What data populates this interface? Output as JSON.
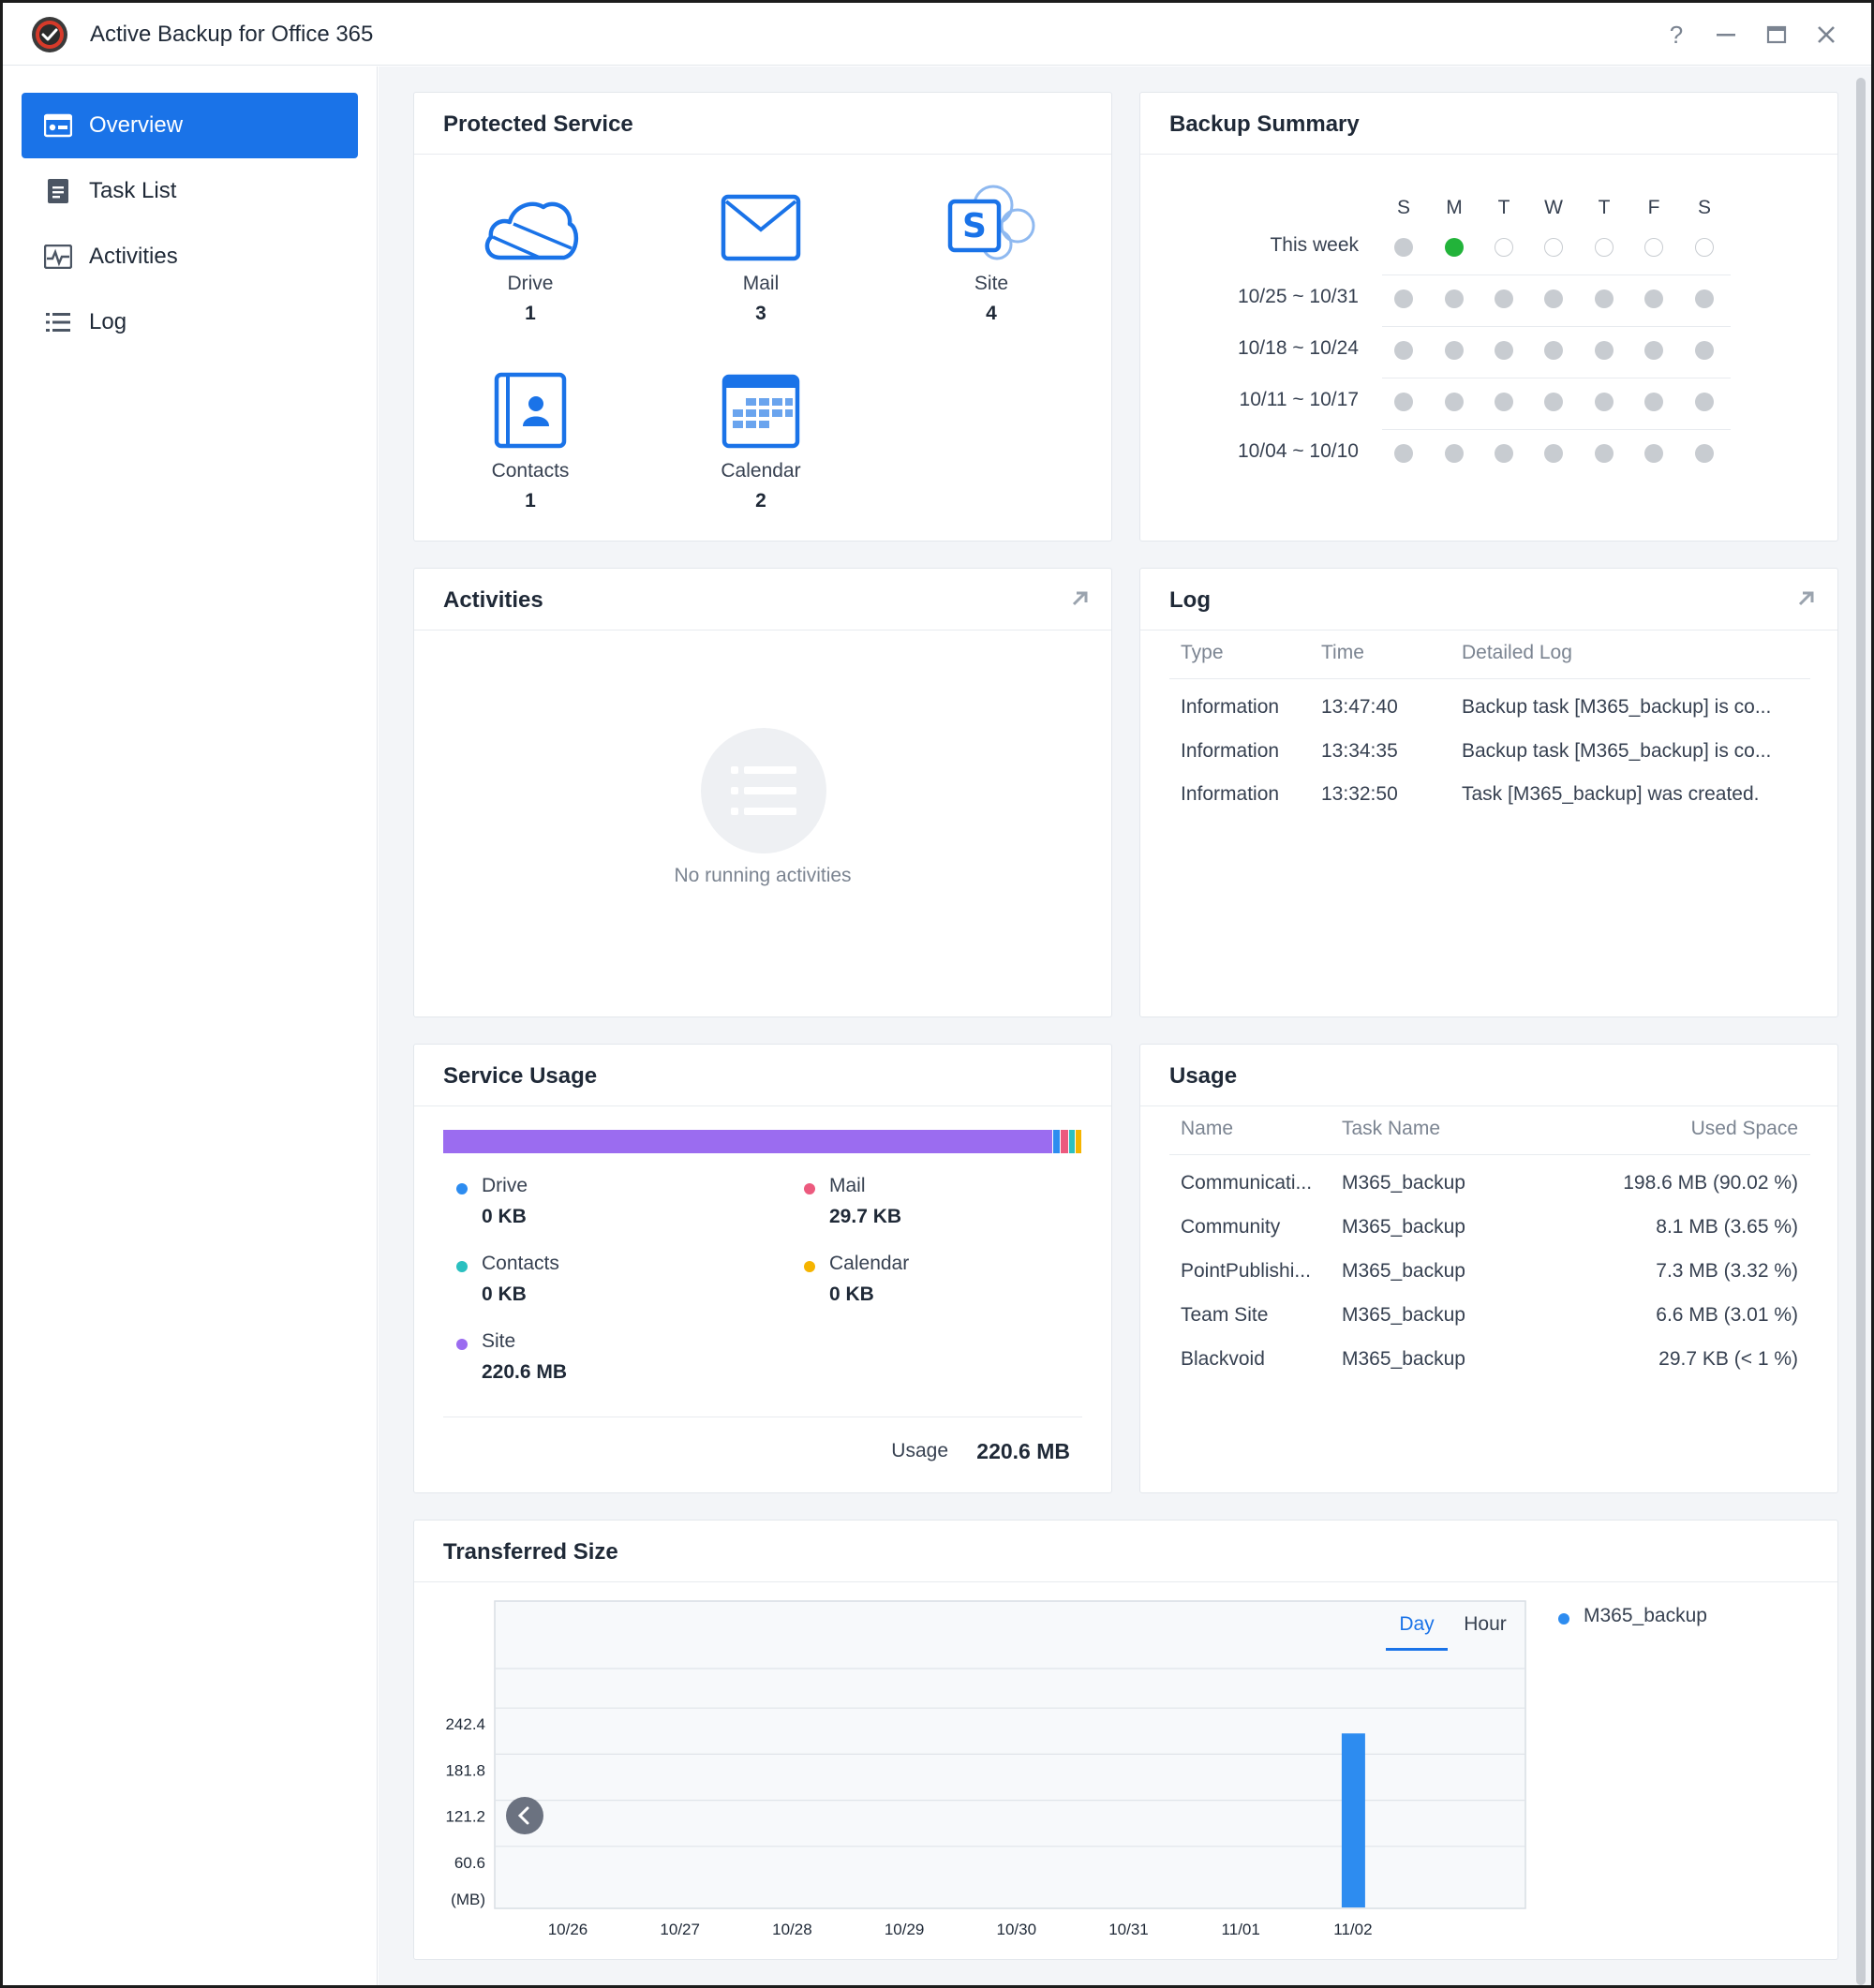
{
  "app": {
    "title": "Active Backup for Office 365"
  },
  "window_buttons": {
    "help": "?"
  },
  "sidebar": {
    "items": [
      {
        "label": "Overview",
        "icon": "overview-icon",
        "active": true
      },
      {
        "label": "Task List",
        "icon": "task-list-icon",
        "active": false
      },
      {
        "label": "Activities",
        "icon": "activities-icon",
        "active": false
      },
      {
        "label": "Log",
        "icon": "log-icon",
        "active": false
      }
    ]
  },
  "protected_service": {
    "title": "Protected Service",
    "services": [
      {
        "name": "Drive",
        "count": "1",
        "icon": "onedrive-cloud-icon"
      },
      {
        "name": "Mail",
        "count": "3",
        "icon": "mail-envelope-icon"
      },
      {
        "name": "Site",
        "count": "4",
        "icon": "sharepoint-site-icon"
      },
      {
        "name": "Contacts",
        "count": "1",
        "icon": "contacts-book-icon"
      },
      {
        "name": "Calendar",
        "count": "2",
        "icon": "calendar-grid-icon"
      }
    ]
  },
  "backup_summary": {
    "title": "Backup Summary",
    "days": [
      "S",
      "M",
      "T",
      "W",
      "T",
      "F",
      "S"
    ],
    "weeks": [
      {
        "label": "This week",
        "status": [
          "gray",
          "green",
          "empty",
          "empty",
          "empty",
          "empty",
          "empty"
        ]
      },
      {
        "label": "10/25 ~ 10/31",
        "status": [
          "gray",
          "gray",
          "gray",
          "gray",
          "gray",
          "gray",
          "gray"
        ]
      },
      {
        "label": "10/18 ~ 10/24",
        "status": [
          "gray",
          "gray",
          "gray",
          "gray",
          "gray",
          "gray",
          "gray"
        ]
      },
      {
        "label": "10/11 ~ 10/17",
        "status": [
          "gray",
          "gray",
          "gray",
          "gray",
          "gray",
          "gray",
          "gray"
        ]
      },
      {
        "label": "10/04 ~ 10/10",
        "status": [
          "gray",
          "gray",
          "gray",
          "gray",
          "gray",
          "gray",
          "gray"
        ]
      }
    ]
  },
  "activities": {
    "title": "Activities",
    "empty_text": "No running activities"
  },
  "log": {
    "title": "Log",
    "columns": [
      "Type",
      "Time",
      "Detailed Log"
    ],
    "rows": [
      {
        "type": "Information",
        "time": "13:47:40",
        "detail": "Backup task [M365_backup] is co..."
      },
      {
        "type": "Information",
        "time": "13:34:35",
        "detail": "Backup task [M365_backup] is co..."
      },
      {
        "type": "Information",
        "time": "13:32:50",
        "detail": "Task [M365_backup] was created."
      }
    ]
  },
  "service_usage": {
    "title": "Service Usage",
    "bar_fractions": [
      {
        "name": "Site",
        "fraction": 0.955,
        "color": "#9b6cf0"
      },
      {
        "name": "Drive",
        "fraction": 0.012,
        "color": "#2d8cf0"
      },
      {
        "name": "Mail",
        "fraction": 0.012,
        "color": "#ec5a7e"
      },
      {
        "name": "Contacts",
        "fraction": 0.011,
        "color": "#2bc0c0"
      },
      {
        "name": "Calendar",
        "fraction": 0.01,
        "color": "#f5b400"
      }
    ],
    "items": [
      {
        "name": "Drive",
        "value": "0 KB",
        "color": "#2d8cf0"
      },
      {
        "name": "Mail",
        "value": "29.7 KB",
        "color": "#ec5a7e"
      },
      {
        "name": "Contacts",
        "value": "0 KB",
        "color": "#2bc0c0"
      },
      {
        "name": "Calendar",
        "value": "0 KB",
        "color": "#f5b400"
      },
      {
        "name": "Site",
        "value": "220.6 MB",
        "color": "#9b6cf0"
      }
    ],
    "total_label": "Usage",
    "total_value": "220.6 MB"
  },
  "usage": {
    "title": "Usage",
    "columns": [
      "Name",
      "Task Name",
      "Used Space"
    ],
    "rows": [
      {
        "name": "Communicati...",
        "task": "M365_backup",
        "space": "198.6 MB (90.02 %)"
      },
      {
        "name": "Community",
        "task": "M365_backup",
        "space": "8.1 MB (3.65 %)"
      },
      {
        "name": "PointPublishi...",
        "task": "M365_backup",
        "space": "7.3 MB (3.32 %)"
      },
      {
        "name": "Team Site",
        "task": "M365_backup",
        "space": "6.6 MB (3.01 %)"
      },
      {
        "name": "Blackvoid",
        "task": "M365_backup",
        "space": "29.7 KB (< 1 %)"
      }
    ]
  },
  "transferred_size": {
    "title": "Transferred Size",
    "tabs": [
      {
        "label": "Day",
        "active": true
      },
      {
        "label": "Hour",
        "active": false
      }
    ],
    "legend": [
      {
        "name": "M365_backup",
        "color": "#2d8cf0"
      }
    ]
  },
  "chart_data": {
    "type": "bar",
    "categories": [
      "10/26",
      "10/27",
      "10/28",
      "10/29",
      "10/30",
      "10/31",
      "11/01",
      "11/02"
    ],
    "series": [
      {
        "name": "M365_backup",
        "values": [
          0,
          0,
          0,
          0,
          0,
          0,
          0,
          230
        ]
      }
    ],
    "yticks": [
      "242.4",
      "181.8",
      "121.2",
      "60.6"
    ],
    "ylabel": "(MB)",
    "ylim": [
      0,
      303
    ],
    "grid": true,
    "legend": "right"
  }
}
